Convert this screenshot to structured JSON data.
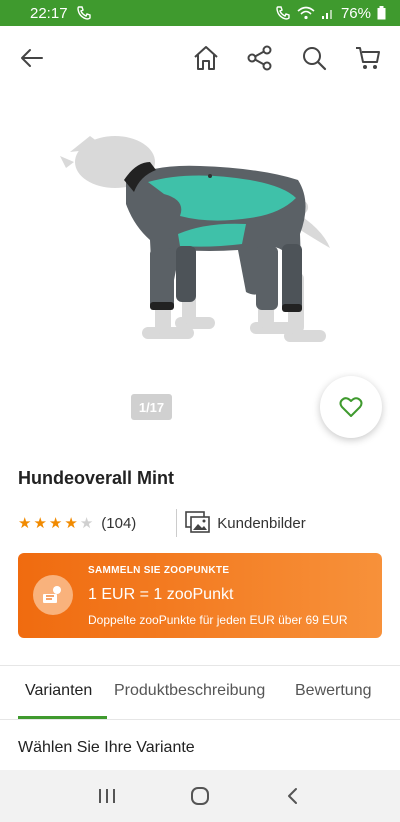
{
  "status": {
    "time": "22:17",
    "battery": "76%"
  },
  "product": {
    "title": "Hundeoverall Mint",
    "image_counter": "1/17",
    "rating_count": "(104)",
    "rating_stars": 4,
    "customer_images_label": "Kundenbilder"
  },
  "promo": {
    "heading": "SAMMELN SIE ZOOPUNKTE",
    "main": "1 EUR = 1 zooPunkt",
    "sub": "Doppelte zooPunkte für jeden EUR über 69 EUR"
  },
  "tabs": [
    {
      "label": "Varianten"
    },
    {
      "label": "Produktbeschreibung"
    },
    {
      "label": "Bewertung"
    }
  ],
  "variant_heading": "Wählen Sie Ihre Variante",
  "colors": {
    "brand_green": "#3f9a2e",
    "promo_orange": "#f06b0f",
    "star_orange": "#f18a00"
  }
}
